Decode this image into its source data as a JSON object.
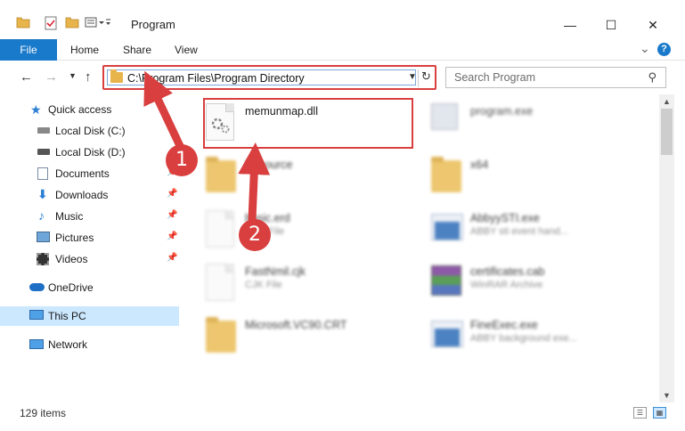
{
  "window": {
    "title": "Program",
    "minimize_glyph": "—",
    "maximize_glyph": "☐",
    "close_glyph": "✕"
  },
  "ribbon": {
    "tabs": [
      {
        "label": "File"
      },
      {
        "label": "Home"
      },
      {
        "label": "Share"
      },
      {
        "label": "View"
      }
    ],
    "collapse_glyph": "⌄",
    "help_glyph": "?"
  },
  "address": {
    "path": "C:\\Program Files\\Program Directory",
    "search_placeholder": "Search Program"
  },
  "sidebar": {
    "items": [
      {
        "label": "Quick access",
        "icon": "star-icon"
      },
      {
        "label": "Local Disk (C:)",
        "icon": "drive-icon"
      },
      {
        "label": "Local Disk (D:)",
        "icon": "drive-icon"
      },
      {
        "label": "Documents",
        "icon": "documents-icon"
      },
      {
        "label": "Downloads",
        "icon": "download-icon"
      },
      {
        "label": "Music",
        "icon": "music-icon"
      },
      {
        "label": "Pictures",
        "icon": "pictures-icon"
      },
      {
        "label": "Videos",
        "icon": "videos-icon"
      },
      {
        "label": "OneDrive",
        "icon": "cloud-icon"
      },
      {
        "label": "This PC",
        "icon": "computer-icon"
      },
      {
        "label": "Network",
        "icon": "network-icon"
      }
    ]
  },
  "files": [
    {
      "name": "memunmap.dll",
      "sub": "",
      "icon": "dll-file-icon"
    },
    {
      "name": "program.exe",
      "sub": "",
      "icon": "exe-file-icon"
    },
    {
      "name": "Resource",
      "sub": "",
      "icon": "folder-icon"
    },
    {
      "name": "x64",
      "sub": "",
      "icon": "folder-icon"
    },
    {
      "name": "basic.erd",
      "sub": "ERD File",
      "icon": "document-file-icon"
    },
    {
      "name": "AbbyySTI.exe",
      "sub": "ABBY sti event hand...",
      "icon": "exe-file-icon"
    },
    {
      "name": "FastNmil.cjk",
      "sub": "CJK File",
      "icon": "document-file-icon"
    },
    {
      "name": "certificates.cab",
      "sub": "WinRAR Archive",
      "icon": "archive-file-icon"
    },
    {
      "name": "Microsoft.VC90.CRT",
      "sub": "",
      "icon": "folder-icon"
    },
    {
      "name": "FineExec.exe",
      "sub": "ABBY background exe...",
      "icon": "exe-file-icon"
    }
  ],
  "status": {
    "item_count": "129 items"
  },
  "annotations": {
    "step1": "1",
    "step2": "2",
    "color": "#d93f3f"
  },
  "colors": {
    "accent": "#1979ca",
    "selection": "#cce8ff",
    "annotation_red": "#d93f3f"
  }
}
